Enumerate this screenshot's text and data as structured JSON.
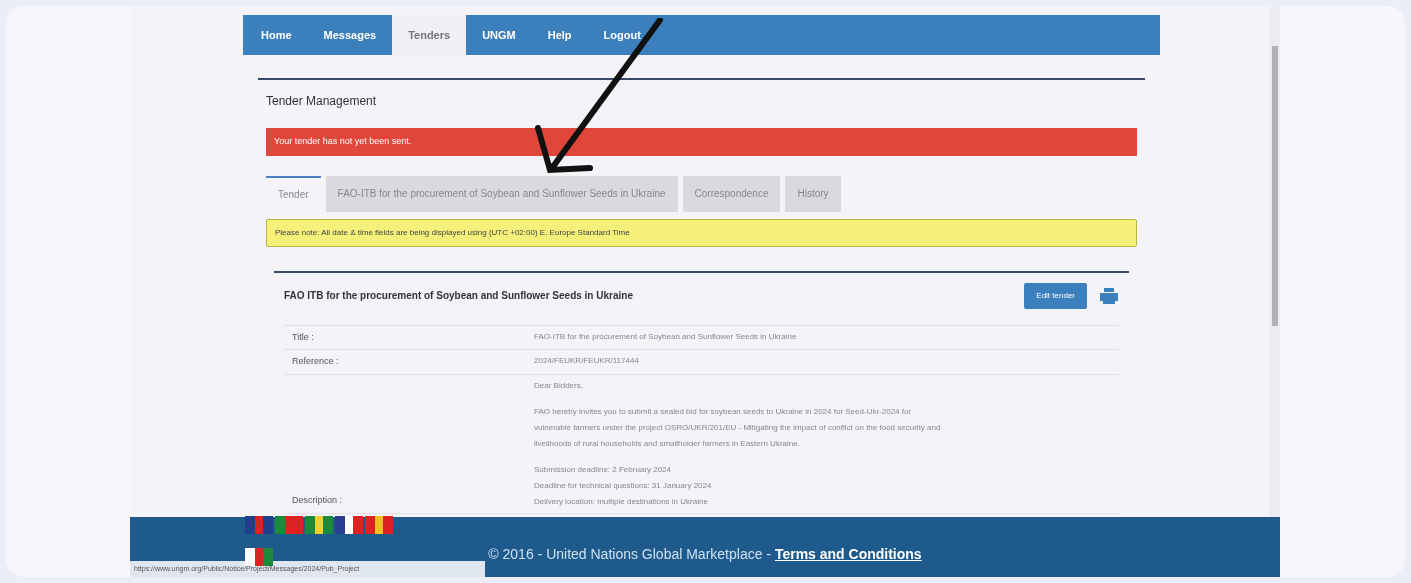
{
  "nav": [
    {
      "label": "Home",
      "selected": false
    },
    {
      "label": "Messages",
      "selected": false
    },
    {
      "label": "Tenders",
      "selected": true
    },
    {
      "label": "UNGM",
      "selected": false
    },
    {
      "label": "Help",
      "selected": false
    },
    {
      "label": "Logout",
      "selected": false
    }
  ],
  "page_title": "Tender Management",
  "alert": "Your tender has not yet been sent.",
  "tabs": [
    {
      "label": "Tender",
      "selected": true
    },
    {
      "label": "FAO-ITB for the procurement of Soybean and Sunflower Seeds in Ukraine",
      "selected": false
    },
    {
      "label": "Correspondence",
      "selected": false
    },
    {
      "label": "History",
      "selected": false
    }
  ],
  "notice": "Please note: All date & time fields are being displayed using (UTC +02:00) E. Europe Standard Time",
  "tender": {
    "heading": "FAO ITB for the procurement of Soybean and Sunflower Seeds in Ukraine",
    "button": "Edit tender",
    "rows": [
      {
        "label": "Title :",
        "lines": [
          "FAO-ITB for the procurement of Soybean and Sunflower Seeds in Ukraine"
        ]
      },
      {
        "label": "Reference :",
        "lines": [
          "2024/FEUKR/FEUKR/117444"
        ]
      },
      {
        "label": "Description :",
        "lines": [
          "Dear Bidders,",
          "FAO hereby invites you to submit a sealed bid for soybean seeds to Ukraine in 2024 for Seed-Ukr-2024 for",
          "vulnerable farmers under the project OSRO/UKR/201/EU - Mitigating the impact of conflict on the food security and",
          "livelihoods of rural households and smallholder farmers in Eastern Ukraine.",
          "Submission deadline: 2 February 2024",
          "Deadline for technical questions: 31 January 2024",
          "Delivery location: multiple destinations in Ukraine"
        ]
      }
    ]
  },
  "footer": {
    "copyright": "© 2016 - United Nations Global Marketplace - ",
    "link": "Terms and Conditions"
  },
  "status_url": "https://www.ungm.org/Public/Notice/Project/Messages/2024/Pub_Project"
}
